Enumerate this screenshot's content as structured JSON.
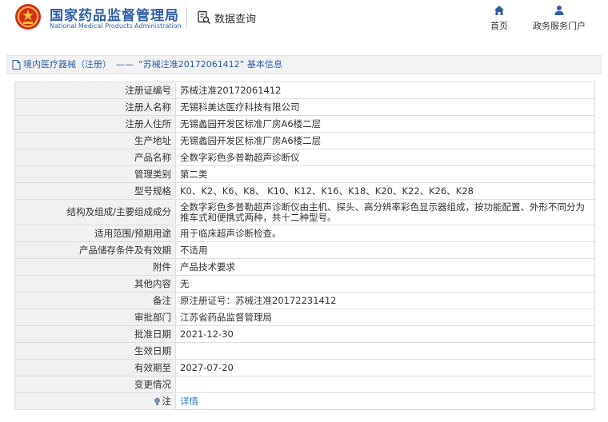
{
  "header": {
    "org_name_cn": "国家药品监督管理局",
    "org_name_en": "National Medical Products Administration",
    "query_label": "数据查询",
    "nav": [
      {
        "label": "首页",
        "icon": "home-icon"
      },
      {
        "label": "政务服务门户",
        "icon": "user-icon"
      }
    ],
    "brand_color": "#2f5fa6"
  },
  "breadcrumb": {
    "icon": "document-icon",
    "section": "境内医疗器械（注册）",
    "separator": "——",
    "current": "“苏械注准20172061412” 基本信息"
  },
  "rows": [
    {
      "label": "注册证编号",
      "value": "苏械注准20172061412"
    },
    {
      "label": "注册人名称",
      "value": "无锡科美达医疗科技有限公司"
    },
    {
      "label": "注册人住所",
      "value": "无锡蠡园开发区标准厂房A6楼二层"
    },
    {
      "label": "生产地址",
      "value": "无锡蠡园开发区标准厂房A6楼二层"
    },
    {
      "label": "产品名称",
      "value": "全数字彩色多普勒超声诊断仪"
    },
    {
      "label": "管理类别",
      "value": "第二类"
    },
    {
      "label": "型号规格",
      "value": "K0、K2、K6、K8、 K10、K12、K16、K18、K20、K22、K26、K28"
    },
    {
      "label": "结构及组成/主要组成成分",
      "value": "全数字彩色多普勒超声诊断仪由主机、探头、高分辨率彩色显示器组成，按功能配置、外形不同分为推车式和便携式两种，共十二种型号。"
    },
    {
      "label": "适用范围/预期用途",
      "value": "用于临床超声诊断检查。"
    },
    {
      "label": "产品储存条件及有效期",
      "value": "不适用"
    },
    {
      "label": "附件",
      "value": "产品技术要求"
    },
    {
      "label": "其他内容",
      "value": "无"
    },
    {
      "label": "备注",
      "value": "原注册证号：苏械注准20172231412"
    },
    {
      "label": "审批部门",
      "value": "江苏省药品监督管理局"
    },
    {
      "label": "批准日期",
      "value": "2021-12-30"
    },
    {
      "label": "生效日期",
      "value": ""
    },
    {
      "label": "有效期至",
      "value": "2027-07-20"
    },
    {
      "label": "变更情况",
      "value": ""
    },
    {
      "label": "注",
      "value": "详情",
      "icon": "lightbulb-icon"
    }
  ]
}
